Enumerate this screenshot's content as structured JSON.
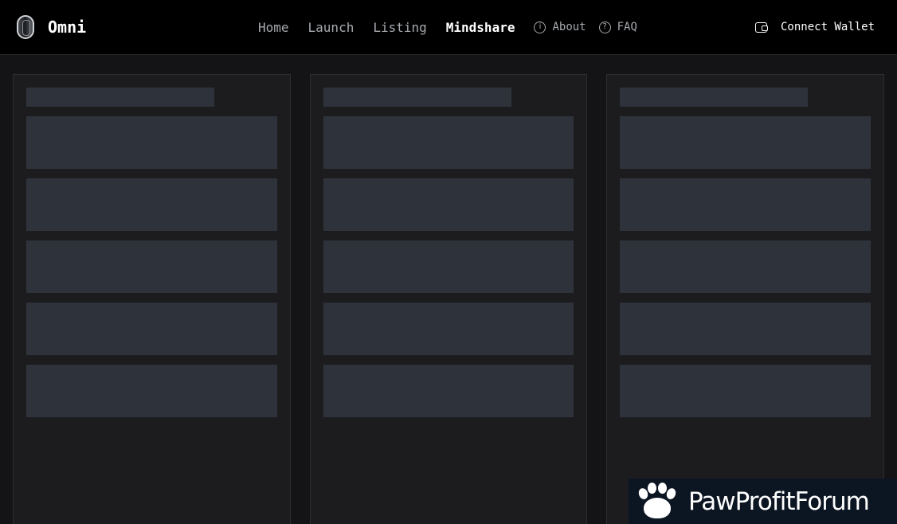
{
  "header": {
    "brand_name": "Omni",
    "nav": {
      "home": "Home",
      "launch": "Launch",
      "listing": "Listing",
      "mindshare": "Mindshare",
      "about": "About",
      "faq": "FAQ"
    },
    "wallet_label": "Connect Wallet",
    "icons": {
      "logo": "omni-logo-icon",
      "about": "info-circle-icon",
      "faq": "question-circle-icon",
      "wallet": "wallet-icon"
    }
  },
  "columns": [
    {
      "state": "loading",
      "skeleton_rows": 5
    },
    {
      "state": "loading",
      "skeleton_rows": 5
    },
    {
      "state": "loading",
      "skeleton_rows": 5
    }
  ],
  "watermark": {
    "text": "PawProfitForum",
    "icon": "paw-icon"
  },
  "colors": {
    "header_bg": "#000000",
    "page_bg": "#141416",
    "panel_bg": "#1c1c1f",
    "skeleton": "#2e333b",
    "nav_inactive": "#a6a9ae",
    "nav_active": "#ffffff"
  }
}
